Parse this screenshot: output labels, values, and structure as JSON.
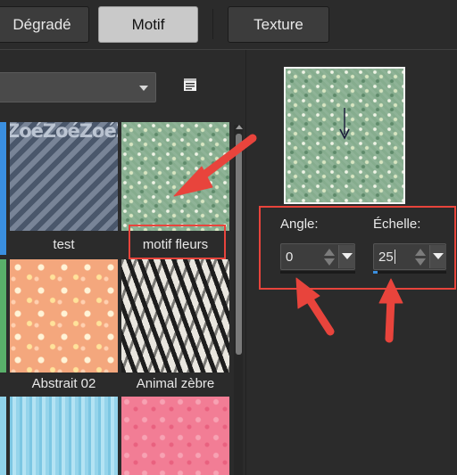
{
  "tabs": [
    {
      "label": "Dégradé",
      "active": false
    },
    {
      "label": "Motif",
      "active": true
    },
    {
      "label": "Texture",
      "active": false
    }
  ],
  "patterns": [
    {
      "name": "test",
      "style": "zoe",
      "tile_text": "ZoéZoéZoéZoéZoéZoéZoéZoéZoé"
    },
    {
      "name": "motif fleurs",
      "style": "flower"
    },
    {
      "name": "Abstrait 02",
      "style": "abstract"
    },
    {
      "name": "Animal zèbre",
      "style": "zebra"
    }
  ],
  "angle": {
    "label": "Angle:",
    "value": "0"
  },
  "scale": {
    "label": "Échelle:",
    "value": "25",
    "slider_fraction": 0.06
  },
  "icons": {
    "list_view": "list-view-icon",
    "preview_marker": "direction-arrow-icon"
  },
  "colors": {
    "background": "#2b2b2b",
    "tab_active": "#c9c9c9",
    "annotation": "#e8443c",
    "accent": "#3a8fe0"
  }
}
